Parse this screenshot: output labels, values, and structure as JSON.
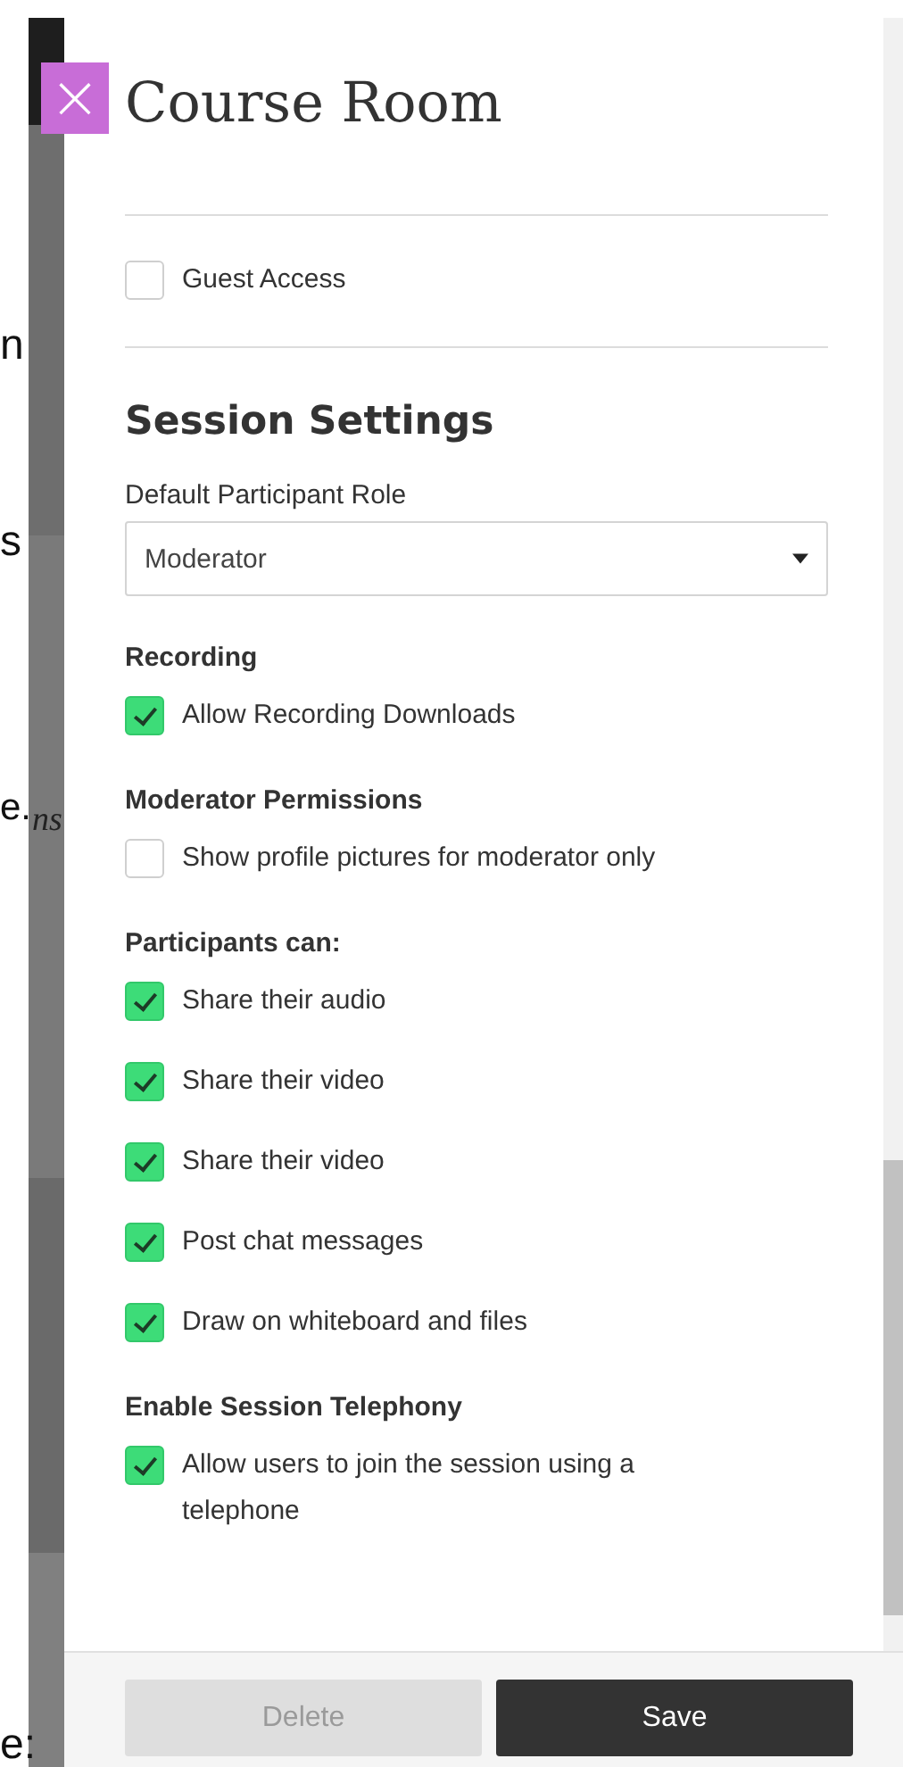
{
  "background_page": {
    "fragments": [
      "n",
      "s",
      "e.",
      "ns",
      "e:"
    ]
  },
  "panel": {
    "close_label": "×",
    "title": "Course Room",
    "items": [
      {
        "kind": "divider"
      },
      {
        "kind": "checkbox",
        "label": "Guest Access",
        "checked": false
      },
      {
        "kind": "divider"
      },
      {
        "kind": "heading",
        "text": "Session Settings"
      },
      {
        "kind": "label",
        "text": "Default Participant Role"
      },
      {
        "kind": "select",
        "value": "Moderator"
      },
      {
        "kind": "subheading",
        "text": "Recording"
      },
      {
        "kind": "checkbox",
        "label": "Allow Recording Downloads",
        "checked": true
      },
      {
        "kind": "subheading",
        "text": "Moderator Permissions"
      },
      {
        "kind": "checkbox",
        "label": "Show profile pictures for moderator only",
        "checked": false
      },
      {
        "kind": "subheading",
        "text": "Participants can:"
      },
      {
        "kind": "checkbox",
        "label": "Share their audio",
        "checked": true
      },
      {
        "kind": "checkbox",
        "label": "Share their video",
        "checked": true
      },
      {
        "kind": "checkbox",
        "label": "Share their video",
        "checked": true
      },
      {
        "kind": "checkbox",
        "label": "Post chat messages",
        "checked": true
      },
      {
        "kind": "checkbox",
        "label": "Draw on whiteboard and files",
        "checked": true
      },
      {
        "kind": "subheading",
        "text": "Enable Session Telephony"
      },
      {
        "kind": "checkbox",
        "label": "Allow users to join the session using a telephone",
        "checked": true
      }
    ],
    "buttons": [
      {
        "label": "Delete",
        "kind": "secondary",
        "disabled": true
      },
      {
        "label": "Save",
        "kind": "primary",
        "disabled": false
      }
    ]
  }
}
